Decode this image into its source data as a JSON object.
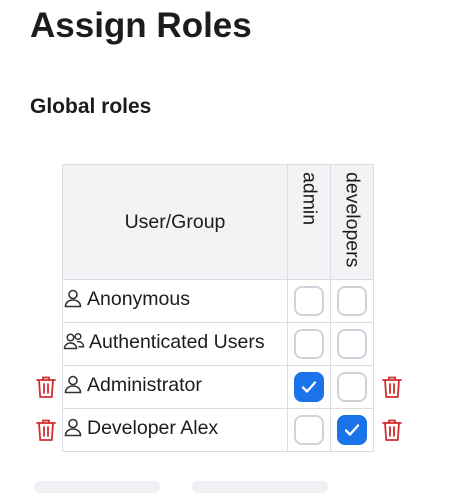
{
  "page": {
    "title": "Assign Roles"
  },
  "section": {
    "title": "Global roles"
  },
  "table": {
    "user_header": "User/Group",
    "roles": [
      "admin",
      "developers"
    ],
    "rows": [
      {
        "name": "Anonymous",
        "icon": "user-icon",
        "checked": [
          false,
          false
        ],
        "deletable": false
      },
      {
        "name": "Authenticated Users",
        "icon": "group-icon",
        "checked": [
          false,
          false
        ],
        "deletable": false
      },
      {
        "name": "Administrator",
        "icon": "user-icon",
        "checked": [
          true,
          false
        ],
        "deletable": true
      },
      {
        "name": "Developer Alex",
        "icon": "user-icon",
        "checked": [
          false,
          true
        ],
        "deletable": true
      }
    ]
  },
  "colors": {
    "accent": "#1a73e8",
    "delete": "#d32f2f"
  }
}
